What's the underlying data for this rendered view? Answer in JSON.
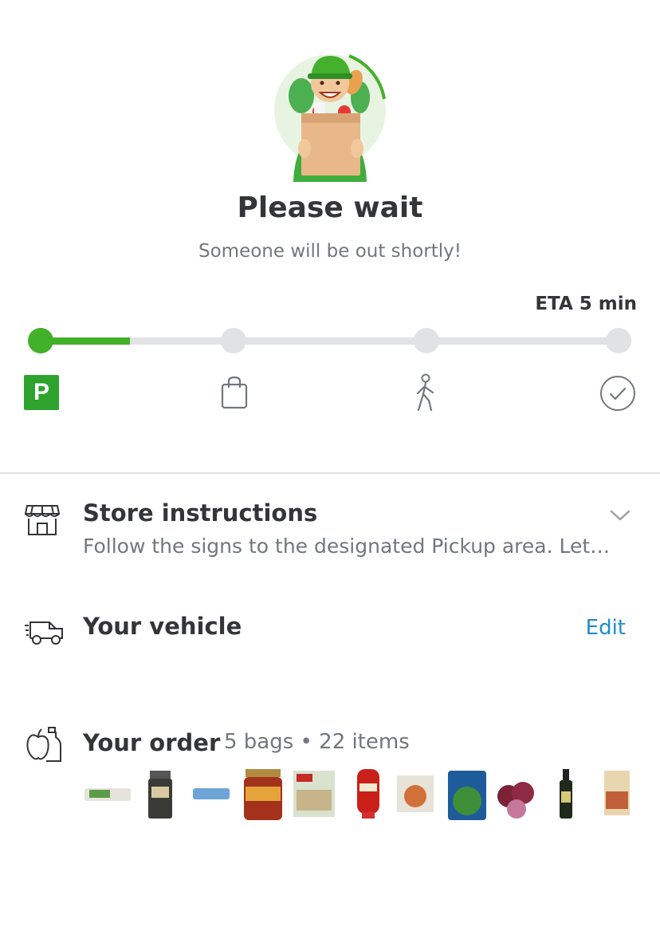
{
  "header": {
    "title": "Please wait",
    "subtitle": "Someone will be out shortly!",
    "illustration": "shopper-with-grocery-bag"
  },
  "eta": "ETA 5 min",
  "progress": {
    "fraction": 0.155,
    "steps": [
      {
        "name": "parking",
        "label": "P",
        "icon": "parking-icon",
        "active": true
      },
      {
        "name": "bagging",
        "icon": "shopping-bag-icon",
        "active": false
      },
      {
        "name": "walking",
        "icon": "walking-person-icon",
        "active": false
      },
      {
        "name": "done",
        "icon": "check-circle-icon",
        "active": false
      }
    ]
  },
  "store_instructions": {
    "title": "Store instructions",
    "text": "Follow the signs to the designated Pickup area. Let…",
    "icon": "storefront-icon"
  },
  "vehicle": {
    "title": "Your vehicle",
    "edit_label": "Edit",
    "icon": "vehicle-icon"
  },
  "order": {
    "title": "Your order",
    "meta": "5 bags • 22 items",
    "icon": "groceries-icon",
    "items": [
      "eggs",
      "seasoning",
      "eggs-carton",
      "salsa",
      "frozen-meal",
      "ketchup",
      "pizza",
      "spinach",
      "red-onions",
      "olive-oil",
      "pasta-box"
    ]
  },
  "colors": {
    "accent": "#43b02a",
    "link": "#1d8ec6",
    "muted": "#72767e",
    "text": "#343538"
  }
}
